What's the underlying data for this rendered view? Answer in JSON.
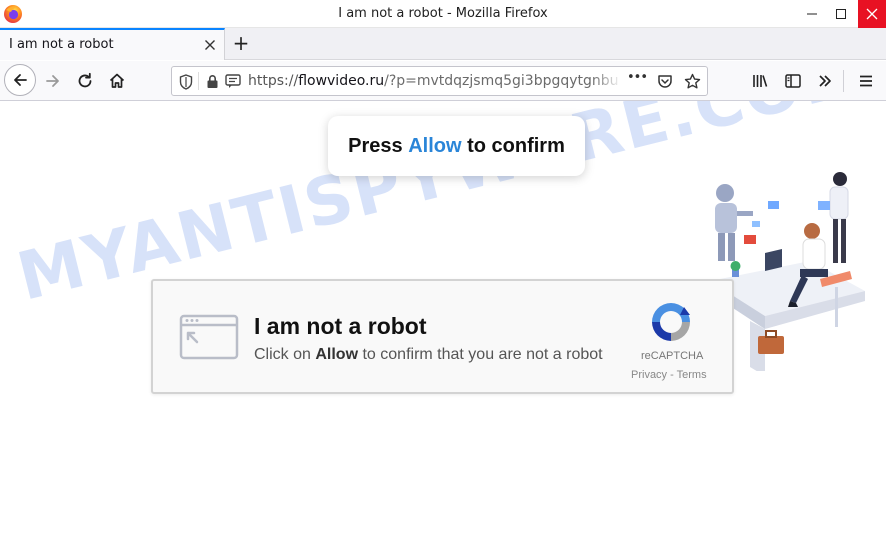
{
  "window": {
    "title": "I am not a robot - Mozilla Firefox",
    "minimize_glyph": "—",
    "maximize_glyph": "☐",
    "close_glyph": "✕"
  },
  "tabs": [
    {
      "label": "I am not a robot",
      "active": true,
      "close_glyph": "✕"
    }
  ],
  "newtab_glyph": "+",
  "urlbar": {
    "scheme": "https://",
    "domain": "flowvideo.ru",
    "path": "/?p=mvtdqzjsmq5gi3bpgqytgnbu",
    "more_glyph": "•••"
  },
  "page": {
    "watermark": "MYANTISPYWARE.COM",
    "popup": {
      "prefix": "Press ",
      "allow": "Allow",
      "suffix": " to confirm"
    },
    "captcha": {
      "title": "I am not a robot",
      "sub_prefix": "Click on ",
      "sub_allow": "Allow",
      "sub_suffix": " to confirm that you are not a robot",
      "brand": "reCAPTCHA",
      "links": "Privacy - Terms"
    }
  },
  "colors": {
    "accent": "#0a84ff",
    "allow_blue": "#2a85d8",
    "close_red": "#e81123",
    "watermark": "#6e96eb"
  },
  "icons": {
    "titlebar": "firefox-logo-icon",
    "nav": [
      "back-arrow-icon",
      "forward-arrow-icon",
      "reload-icon",
      "home-icon"
    ],
    "urlbar": [
      "shield-icon",
      "lock-icon",
      "notification-icon",
      "pocket-icon",
      "star-icon"
    ],
    "toolbar": [
      "library-icon",
      "sidebar-icon",
      "overflow-chevrons-icon",
      "hamburger-menu-icon"
    ]
  }
}
